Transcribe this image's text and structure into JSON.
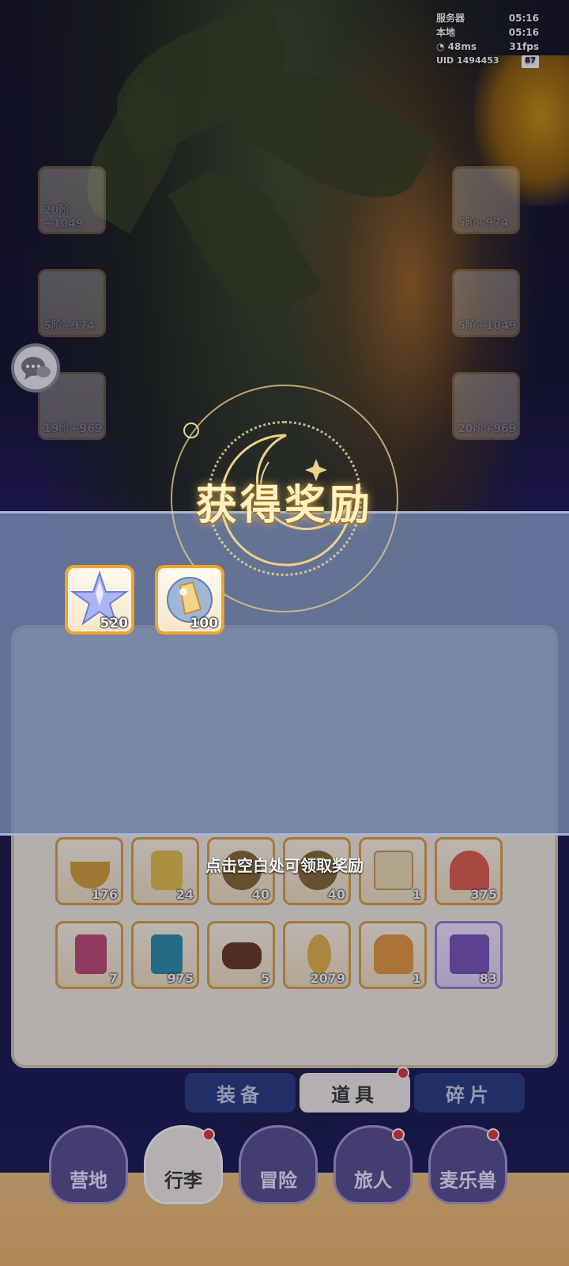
{
  "status": {
    "server_label": "服务器",
    "server_time": "05:16",
    "local_label": "本地",
    "local_time": "05:16",
    "ping": "48ms",
    "fps": "31fps",
    "uid": "UID 1494453",
    "battery": "87"
  },
  "equipment": {
    "left": [
      {
        "level": "20阶+1049",
        "icon": "weapon-icon"
      },
      {
        "level": "5阶+974",
        "icon": "armor-icon"
      },
      {
        "level": "19阶+969",
        "icon": "accessory-icon"
      }
    ],
    "right": [
      {
        "level": "5阶+974",
        "icon": "helmet-icon"
      },
      {
        "level": "5阶+1049",
        "icon": "gloves-icon"
      },
      {
        "level": "20阶+969",
        "icon": "boots-icon"
      }
    ]
  },
  "bag_items": [
    {
      "count": "176",
      "icon": "bowl-icon"
    },
    {
      "count": "24",
      "icon": "ink-bottle-icon"
    },
    {
      "count": "40",
      "icon": "gem-badge-icon"
    },
    {
      "count": "40",
      "icon": "gem-badge-icon"
    },
    {
      "count": "1",
      "icon": "scroll-icon"
    },
    {
      "count": "375",
      "icon": "iron-icon"
    },
    {
      "count": "7",
      "icon": "red-card-icon"
    },
    {
      "count": "975",
      "icon": "blue-card-icon"
    },
    {
      "count": "5",
      "icon": "log-icon"
    },
    {
      "count": "2079",
      "icon": "key-icon"
    },
    {
      "count": "1",
      "icon": "backpack-icon"
    },
    {
      "count": "83",
      "icon": "stamp-icon"
    }
  ],
  "tabs": {
    "equipment": "装备",
    "items": "道具",
    "fragments": "碎片"
  },
  "nav": {
    "camp": "营地",
    "luggage": "行李",
    "adventure": "冒险",
    "travelers": "旅人",
    "creatures": "麦乐兽"
  },
  "reward": {
    "title": "获得奖励",
    "items": [
      {
        "icon": "star-crystal-icon",
        "count": "520"
      },
      {
        "icon": "crystal-orb-icon",
        "count": "100"
      }
    ],
    "hint": "点击空白处可领取奖励"
  },
  "colors": {
    "accent_gold": "#f0a233",
    "band": "#7080a5",
    "title": "#fff2c2"
  }
}
